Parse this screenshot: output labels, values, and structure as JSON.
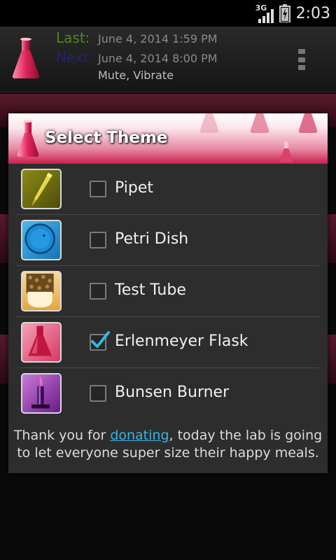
{
  "status_bar": {
    "network": "3G",
    "time": "2:03"
  },
  "alarm": {
    "last_label": "Last:",
    "last_value": "June 4, 2014 1:59 PM",
    "next_label": "Next:",
    "next_value": "June 4, 2014 8:00 PM",
    "modes": "Mute, Vibrate"
  },
  "dialog": {
    "title": "Select Theme",
    "themes": [
      {
        "label": "Pipet",
        "icon": "pipet-icon",
        "checked": false
      },
      {
        "label": "Petri Dish",
        "icon": "petri-dish-icon",
        "checked": false
      },
      {
        "label": "Test Tube",
        "icon": "test-tube-icon",
        "checked": false
      },
      {
        "label": "Erlenmeyer Flask",
        "icon": "erlenmeyer-flask-icon",
        "checked": true
      },
      {
        "label": "Bunsen Burner",
        "icon": "bunsen-burner-icon",
        "checked": false
      }
    ],
    "footer": {
      "before": "Thank you for ",
      "link": "donating",
      "after": ", today the lab is going to let everyone super size their happy meals."
    }
  },
  "colors": {
    "accent_pink": "#c91f4c",
    "link_blue": "#33b5e5",
    "check_blue": "#33b5e5"
  }
}
